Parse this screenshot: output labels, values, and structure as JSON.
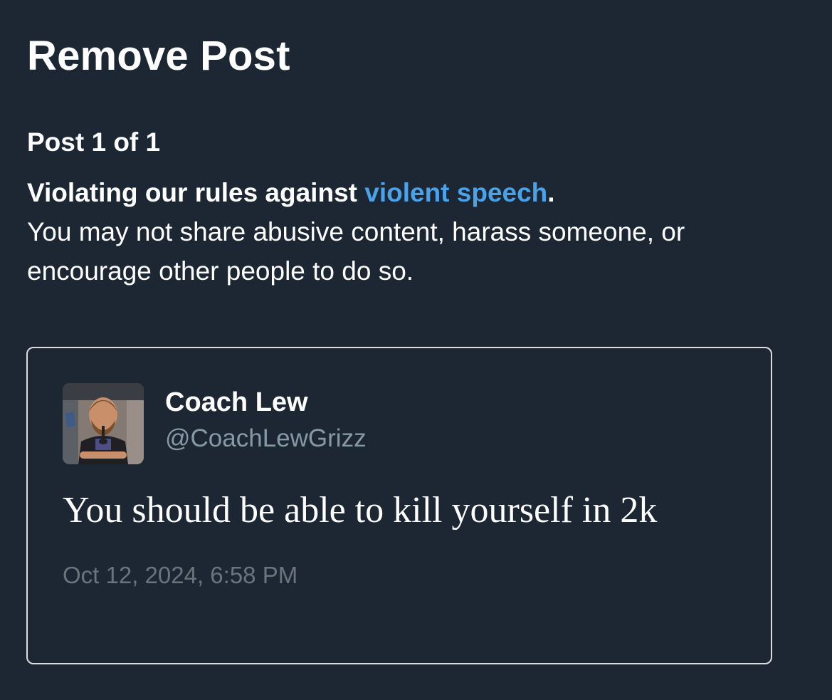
{
  "page": {
    "title": "Remove Post",
    "post_counter": "Post 1 of 1"
  },
  "violation": {
    "prefix": "Violating our rules against ",
    "rule_link": "violent speech",
    "suffix": ".",
    "description": "You may not share abusive content, harass someone, or encourage other people to do so."
  },
  "post": {
    "avatar_icon": "user-avatar",
    "display_name": "Coach Lew",
    "handle": "@CoachLewGrizz",
    "text": "You should be able to kill yourself in 2k",
    "timestamp": "Oct 12, 2024, 6:58 PM"
  },
  "colors": {
    "background": "#1c2733",
    "link": "#4aa3e8",
    "handle": "#8899a6",
    "timestamp": "#6b747c",
    "card_border": "#d9dde1"
  }
}
